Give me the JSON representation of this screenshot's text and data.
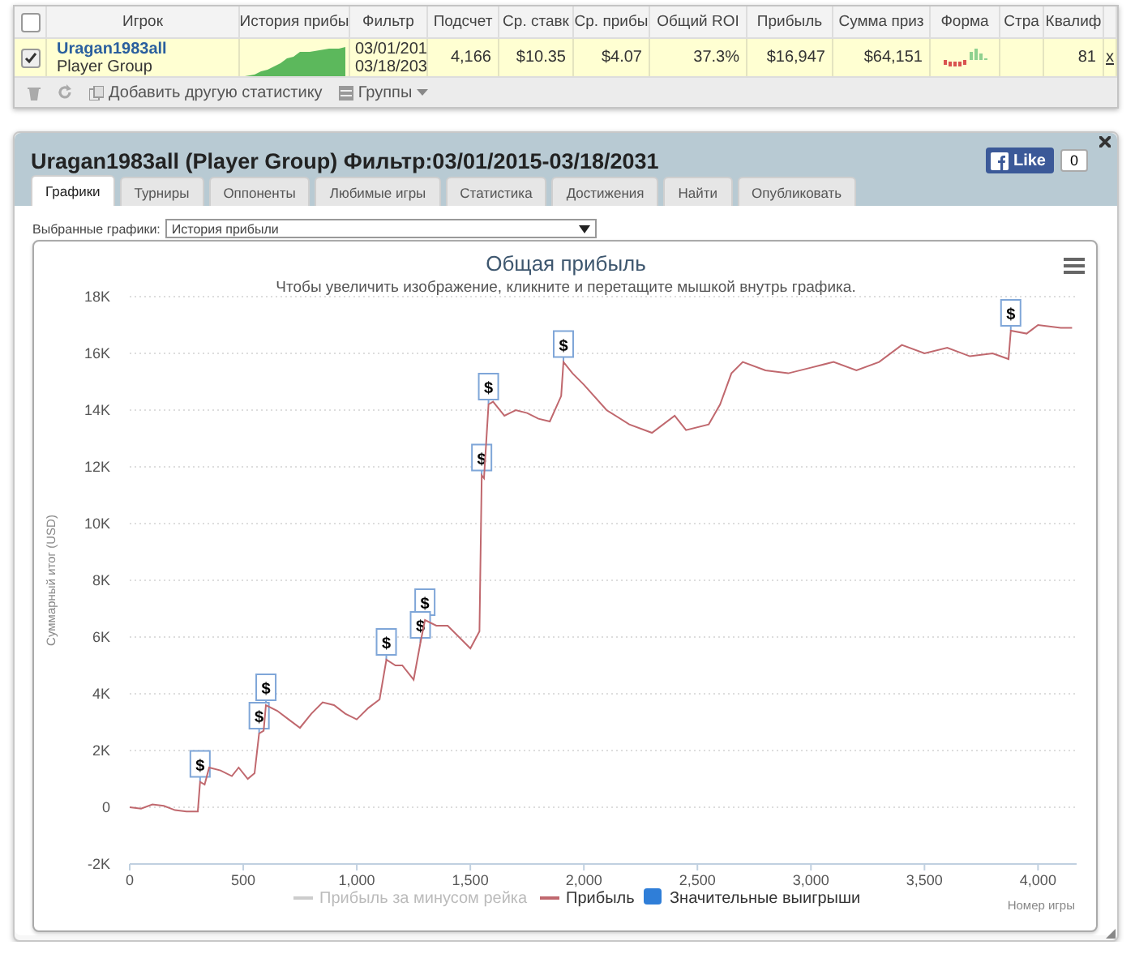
{
  "table": {
    "header_checked": false,
    "columns": [
      {
        "label": "Игрок"
      },
      {
        "label": "История прибы"
      },
      {
        "label": "Фильтр"
      },
      {
        "label": "Подсчет"
      },
      {
        "label": "Ср. ставк"
      },
      {
        "label": "Ср. прибы"
      },
      {
        "label": "Общий ROI"
      },
      {
        "label": "Прибыль"
      },
      {
        "label": "Сумма приз"
      },
      {
        "label": "Форма"
      },
      {
        "label": "Стра"
      },
      {
        "label": "Квалиф"
      }
    ],
    "rows": [
      {
        "checked": true,
        "player": "Uragan1983all",
        "group": "Player Group",
        "filter": [
          "03/01/201",
          "03/18/203"
        ],
        "values": [
          "4,166",
          "$10.35",
          "$4.07",
          "37.3%",
          "$16,947",
          "$64,151"
        ],
        "qualif": "81",
        "remove": "x"
      }
    ],
    "toolbar": [
      {
        "kind": "delete"
      },
      {
        "kind": "refresh"
      },
      {
        "kind": "add",
        "label": "Добавить другую статистику"
      },
      {
        "kind": "groups",
        "label": "Группы"
      }
    ]
  },
  "panel": {
    "title": "Uragan1983all (Player Group) Фильтр:03/01/2015-03/18/2031",
    "like": {
      "label": "Like",
      "count": "0"
    },
    "tabs": [
      {
        "label": "Графики",
        "selected": true
      },
      {
        "label": "Турниры",
        "selected": false
      },
      {
        "label": "Оппоненты",
        "selected": false
      },
      {
        "label": "Любимые игры",
        "selected": false
      },
      {
        "label": "Статистика",
        "selected": false
      },
      {
        "label": "Достижения",
        "selected": false
      },
      {
        "label": "Найти",
        "selected": false
      },
      {
        "label": "Опубликовать",
        "selected": false
      }
    ],
    "chart_select": {
      "label": "Выбранные графики:",
      "value": "История прибыли"
    },
    "chart": {
      "subtitle": "Чтобы увеличить изображение, кликните и перетащите мышкой внутрь графика.",
      "legend": [
        {
          "label": "Прибыль за минусом рейка",
          "kind": "line",
          "visible": false
        },
        {
          "kind": "series",
          "visible": true
        },
        {
          "label": "Значительные выигрыши",
          "kind": "square",
          "color": "#2f7ed8",
          "visible": true
        }
      ],
      "chart_data": {
        "type": "line",
        "title": "Общая прибыль",
        "xlabel": "Номер игры",
        "ylabel": "Суммарный итог (USD)",
        "grid": true,
        "x": [
          0,
          50,
          100,
          150,
          200,
          250,
          300,
          310,
          330,
          350,
          400,
          450,
          480,
          520,
          550,
          570,
          590,
          600,
          650,
          700,
          750,
          800,
          850,
          900,
          950,
          1000,
          1050,
          1100,
          1130,
          1170,
          1200,
          1250,
          1280,
          1300,
          1350,
          1400,
          1450,
          1500,
          1540,
          1550,
          1560,
          1580,
          1600,
          1650,
          1700,
          1750,
          1800,
          1850,
          1900,
          1910,
          1950,
          2000,
          2100,
          2200,
          2300,
          2400,
          2450,
          2550,
          2600,
          2650,
          2700,
          2800,
          2900,
          3000,
          3100,
          3200,
          3300,
          3400,
          3500,
          3600,
          3700,
          3800,
          3870,
          3880,
          3950,
          4000,
          4100,
          4150
        ],
        "series": [
          {
            "name": "Прибыль",
            "color": "#c0686e",
            "values": [
              0,
              -50,
              100,
              50,
              -100,
              -150,
              -150,
              900,
              800,
              1400,
              1300,
              1100,
              1400,
              1000,
              1200,
              2600,
              2700,
              3600,
              3400,
              3100,
              2800,
              3300,
              3700,
              3600,
              3300,
              3100,
              3500,
              3800,
              5200,
              5000,
              5000,
              4500,
              5800,
              6600,
              6400,
              6400,
              6000,
              5600,
              6200,
              11700,
              11600,
              14200,
              14300,
              13800,
              14000,
              13900,
              13700,
              13600,
              14500,
              15700,
              15300,
              14900,
              14000,
              13500,
              13200,
              13800,
              13300,
              13500,
              14200,
              15300,
              15700,
              15400,
              15300,
              15500,
              15700,
              15400,
              15700,
              16300,
              16000,
              16200,
              15900,
              16000,
              15800,
              16800,
              16700,
              17000,
              16900,
              16900
            ]
          }
        ],
        "xlim": [
          0,
          4170
        ],
        "ylim": [
          -2000,
          18000
        ],
        "xticks": [
          {
            "value": 0,
            "label": "0"
          },
          {
            "value": 500,
            "label": "500"
          },
          {
            "value": 1000,
            "label": "1,000"
          },
          {
            "value": 1500,
            "label": "1,500"
          },
          {
            "value": 2000,
            "label": "2,000"
          },
          {
            "value": 2500,
            "label": "2,500"
          },
          {
            "value": 3000,
            "label": "3,000"
          },
          {
            "value": 3500,
            "label": "3,500"
          },
          {
            "value": 4000,
            "label": "4,000"
          }
        ],
        "yticks": [
          {
            "value": -2000,
            "label": "-2K"
          },
          {
            "value": 0,
            "label": "0"
          },
          {
            "value": 2000,
            "label": "2K"
          },
          {
            "value": 4000,
            "label": "4K"
          },
          {
            "value": 6000,
            "label": "6K"
          },
          {
            "value": 8000,
            "label": "8K"
          },
          {
            "value": 10000,
            "label": "10K"
          },
          {
            "value": 12000,
            "label": "12K"
          },
          {
            "value": 14000,
            "label": "14K"
          },
          {
            "value": 16000,
            "label": "16K"
          },
          {
            "value": 18000,
            "label": "18K"
          }
        ],
        "annotations": [
          {
            "x": 310,
            "y": 900,
            "text": "$"
          },
          {
            "x": 570,
            "y": 2600,
            "text": "$"
          },
          {
            "x": 600,
            "y": 3600,
            "text": "$"
          },
          {
            "x": 1130,
            "y": 5200,
            "text": "$"
          },
          {
            "x": 1280,
            "y": 5800,
            "text": "$"
          },
          {
            "x": 1300,
            "y": 6600,
            "text": "$"
          },
          {
            "x": 1550,
            "y": 11700,
            "text": "$"
          },
          {
            "x": 1580,
            "y": 14200,
            "text": "$"
          },
          {
            "x": 1910,
            "y": 15700,
            "text": "$"
          },
          {
            "x": 3880,
            "y": 16800,
            "text": "$"
          }
        ]
      }
    }
  }
}
